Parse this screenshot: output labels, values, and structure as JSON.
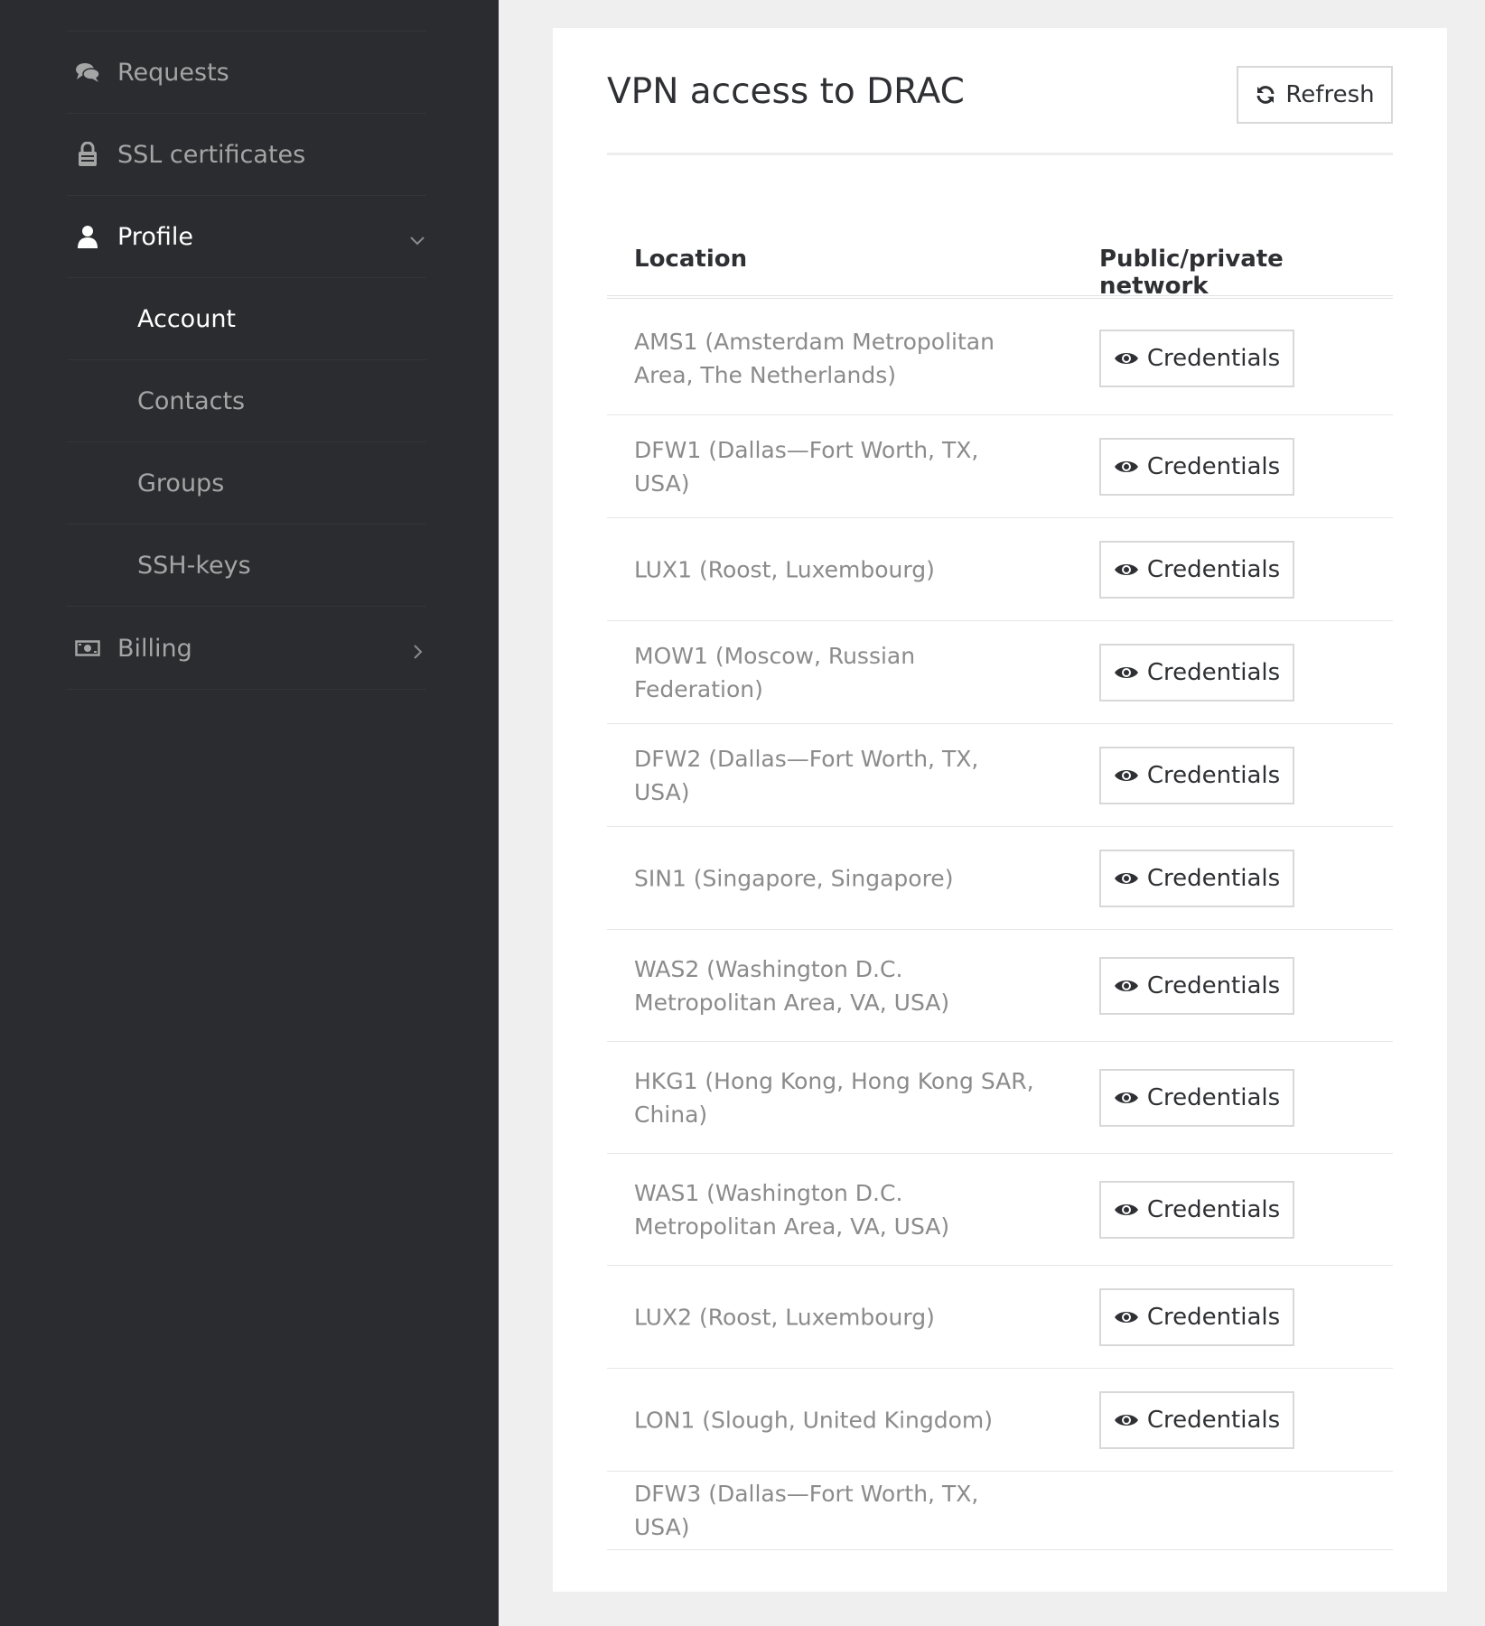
{
  "sidebar": {
    "items": [
      {
        "label": "Requests",
        "icon": "comments-icon"
      },
      {
        "label": "SSL certificates",
        "icon": "ssl-lock-icon"
      },
      {
        "label": "Profile",
        "icon": "user-icon",
        "expanded": true
      },
      {
        "label": "Billing",
        "icon": "money-icon",
        "expanded": false
      }
    ],
    "profile_subitems": [
      {
        "label": "Account",
        "current": true
      },
      {
        "label": "Contacts"
      },
      {
        "label": "Groups"
      },
      {
        "label": "SSH-keys"
      }
    ]
  },
  "main": {
    "title": "VPN access to DRAC",
    "refresh_label": "Refresh",
    "table": {
      "headers": [
        "Location",
        "Public/private network"
      ],
      "rows": [
        {
          "location": "AMS1 (Amsterdam Metropolitan Area, The Netherlands)",
          "action": "Credentials"
        },
        {
          "location": "DFW1 (Dallas—Fort Worth, TX, USA)",
          "action": "Credentials"
        },
        {
          "location": "LUX1 (Roost, Luxembourg)",
          "action": "Credentials"
        },
        {
          "location": "MOW1 (Moscow, Russian Federation)",
          "action": "Credentials"
        },
        {
          "location": "DFW2 (Dallas—Fort Worth, TX, USA)",
          "action": "Credentials"
        },
        {
          "location": "SIN1 (Singapore, Singapore)",
          "action": "Credentials"
        },
        {
          "location": "WAS2 (Washington D.C. Metropolitan Area, VA, USA)",
          "action": "Credentials"
        },
        {
          "location": "HKG1 (Hong Kong, Hong Kong SAR, China)",
          "action": "Credentials"
        },
        {
          "location": "WAS1 (Washington D.C. Metropolitan Area, VA, USA)",
          "action": "Credentials"
        },
        {
          "location": "LUX2 (Roost, Luxembourg)",
          "action": "Credentials"
        },
        {
          "location": "LON1 (Slough, United Kingdom)",
          "action": "Credentials"
        },
        {
          "location": "DFW3 (Dallas—Fort Worth, TX, USA)",
          "action": ""
        }
      ]
    }
  },
  "colors": {
    "sidebar_bg": "#2b2c2f",
    "page_bg": "#efefef",
    "card_bg": "#ffffff",
    "text_dark": "#2f3033",
    "text_muted": "#8b8b8c",
    "nav_text": "#a5a5a6",
    "nav_active": "#ffffff"
  }
}
